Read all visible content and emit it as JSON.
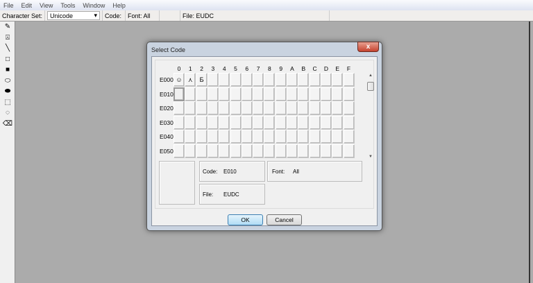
{
  "menu": [
    "File",
    "Edit",
    "View",
    "Tools",
    "Window",
    "Help"
  ],
  "toolbar": {
    "charset_label": "Character Set:",
    "charset_value": "Unicode",
    "code_label": "Code:",
    "font_label": "Font: All",
    "file_label": "File: EUDC"
  },
  "tools": [
    "pencil-icon",
    "brush-icon",
    "line-icon",
    "hollow-rectangle-icon",
    "filled-rectangle-icon",
    "hollow-ellipse-icon",
    "filled-ellipse-icon",
    "rectangular-selection-icon",
    "freeform-selection-icon",
    "eraser-icon"
  ],
  "dialog": {
    "title": "Select Code",
    "close": "x",
    "columns": [
      "0",
      "1",
      "2",
      "3",
      "4",
      "5",
      "6",
      "7",
      "8",
      "9",
      "A",
      "B",
      "C",
      "D",
      "E",
      "F"
    ],
    "rows": [
      "E000",
      "E010",
      "E020",
      "E030",
      "E040",
      "E050"
    ],
    "glyphs": {
      "E000": "☺",
      "E001": "⋏",
      "E002": "Ƃ"
    },
    "selected": "E010",
    "code_label": "Code:",
    "code_value": "E010",
    "font_label": "Font:",
    "font_value": "All",
    "file_label": "File:",
    "file_value": "EUDC",
    "ok": "OK",
    "cancel": "Cancel"
  }
}
